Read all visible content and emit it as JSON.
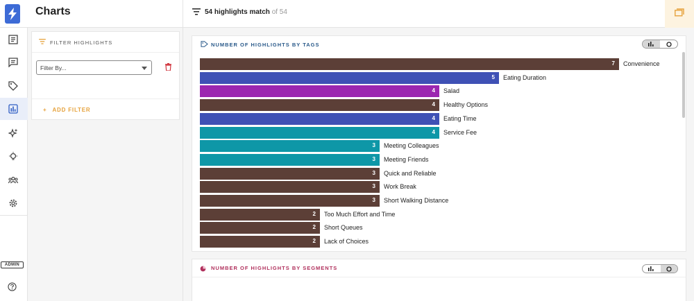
{
  "header": {
    "title": "Charts",
    "match_count": "54 highlights match",
    "match_total": "of 54"
  },
  "nav": {
    "items": [
      "document-icon",
      "comment-icon",
      "tag-icon",
      "bar-chart-icon",
      "sparkle-icon",
      "lightbulb-icon",
      "people-icon",
      "gear-icon"
    ],
    "active": "bar-chart-icon",
    "admin_badge": "ADMIN"
  },
  "filter_panel": {
    "title": "FILTER HIGHLIGHTS",
    "select_placeholder": "Filter By...",
    "add_filter": "ADD FILTER"
  },
  "tags_card": {
    "title": "NUMBER OF HIGHLIGHTS BY TAGS",
    "view_toggle": {
      "selected": "bar"
    }
  },
  "segments_card": {
    "title": "NUMBER OF HIGHLIGHTS BY SEGMENTS",
    "view_toggle": {
      "selected": "pie"
    }
  },
  "colors": {
    "brown": "#5c3f37",
    "blue": "#3f51b5",
    "purple": "#9c27b0",
    "teal": "#0e97a7",
    "accent": "#e6a23c"
  },
  "chart_data": {
    "type": "bar",
    "orientation": "horizontal",
    "title": "NUMBER OF HIGHLIGHTS BY TAGS",
    "max_value": 7,
    "bars": [
      {
        "label": "Convenience",
        "value": 7,
        "color": "#5c3f37"
      },
      {
        "label": "Eating Duration",
        "value": 5,
        "color": "#3f51b5"
      },
      {
        "label": "Salad",
        "value": 4,
        "color": "#9c27b0"
      },
      {
        "label": "Healthy Options",
        "value": 4,
        "color": "#5c3f37"
      },
      {
        "label": "Eating Time",
        "value": 4,
        "color": "#3f51b5"
      },
      {
        "label": "Service Fee",
        "value": 4,
        "color": "#0e97a7"
      },
      {
        "label": "Meeting Colleagues",
        "value": 3,
        "color": "#0e97a7"
      },
      {
        "label": "Meeting Friends",
        "value": 3,
        "color": "#0e97a7"
      },
      {
        "label": "Quick and Reliable",
        "value": 3,
        "color": "#5c3f37"
      },
      {
        "label": "Work Break",
        "value": 3,
        "color": "#5c3f37"
      },
      {
        "label": "Short Walking Distance",
        "value": 3,
        "color": "#5c3f37"
      },
      {
        "label": "Too Much Effort and Time",
        "value": 2,
        "color": "#5c3f37"
      },
      {
        "label": "Short Queues",
        "value": 2,
        "color": "#5c3f37"
      },
      {
        "label": "Lack of Choices",
        "value": 2,
        "color": "#5c3f37"
      }
    ]
  }
}
